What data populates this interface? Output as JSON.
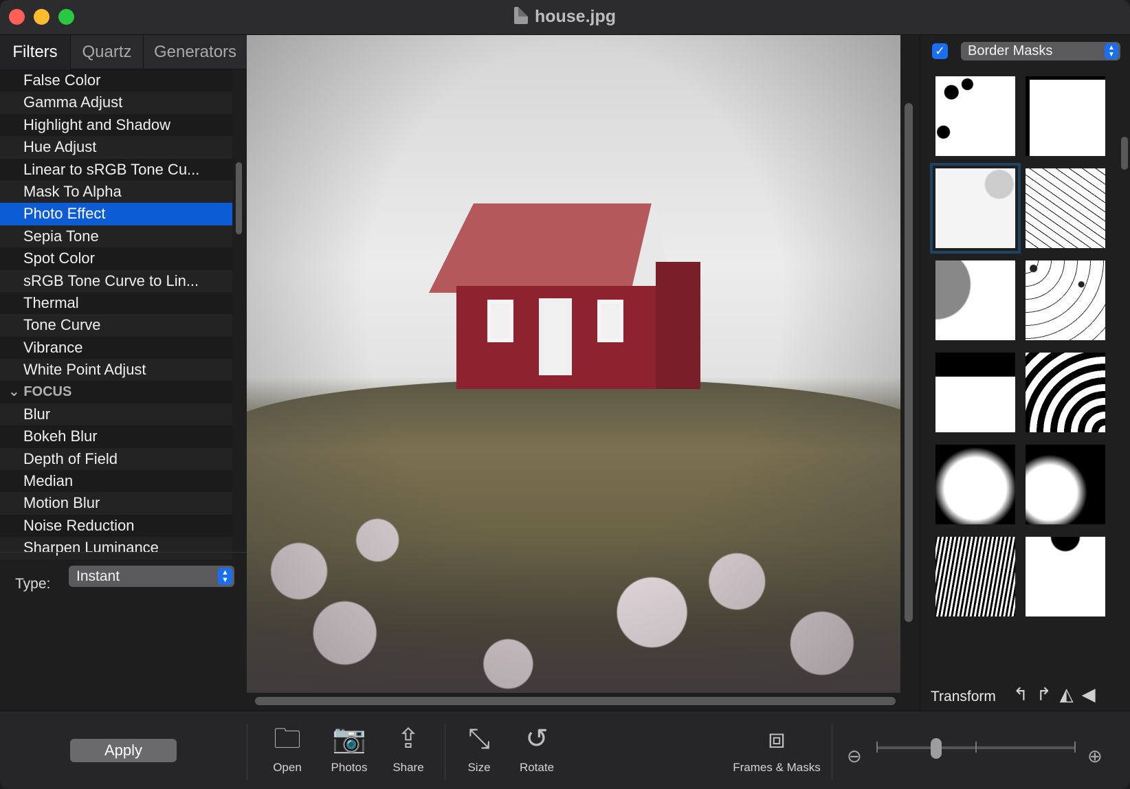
{
  "window": {
    "title": "house.jpg"
  },
  "tabs": [
    "Filters",
    "Quartz",
    "Generators"
  ],
  "filter_list": [
    {
      "label": "False Color"
    },
    {
      "label": "Gamma Adjust"
    },
    {
      "label": "Highlight and Shadow"
    },
    {
      "label": "Hue Adjust"
    },
    {
      "label": "Linear to sRGB Tone Cu..."
    },
    {
      "label": "Mask To Alpha"
    },
    {
      "label": "Photo Effect",
      "selected": true
    },
    {
      "label": "Sepia Tone"
    },
    {
      "label": "Spot Color"
    },
    {
      "label": "sRGB Tone Curve to Lin..."
    },
    {
      "label": "Thermal"
    },
    {
      "label": "Tone Curve"
    },
    {
      "label": "Vibrance"
    },
    {
      "label": "White Point Adjust"
    },
    {
      "label": "FOCUS",
      "header": true
    },
    {
      "label": "Blur"
    },
    {
      "label": "Bokeh Blur"
    },
    {
      "label": "Depth of Field"
    },
    {
      "label": "Median"
    },
    {
      "label": "Motion Blur"
    },
    {
      "label": "Noise Reduction"
    },
    {
      "label": "Sharpen Luminance"
    }
  ],
  "type_control": {
    "label": "Type:",
    "value": "Instant"
  },
  "masks": {
    "enabled": true,
    "category": "Border Masks",
    "count_visible": 12,
    "selected_index": 2
  },
  "transform": {
    "label": "Transform"
  },
  "toolbar": {
    "apply_label": "Apply",
    "open_label": "Open",
    "photos_label": "Photos",
    "share_label": "Share",
    "size_label": "Size",
    "rotate_label": "Rotate",
    "frames_label": "Frames & Masks"
  },
  "zoom": {
    "level_fraction": 0.3
  },
  "colors": {
    "accent": "#0b5cd5",
    "selection": "#0b5cd5"
  }
}
